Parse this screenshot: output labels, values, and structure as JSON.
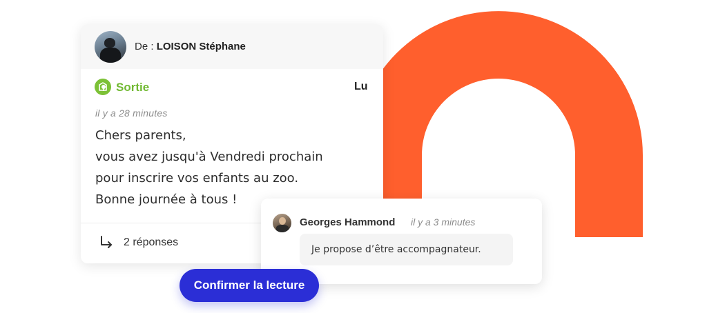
{
  "colors": {
    "accent_orange": "#ff5f2d",
    "category_green": "#7cc136",
    "button_blue": "#2b2ed6"
  },
  "message": {
    "from_prefix": "De :",
    "from_name": "LOISON Stéphane",
    "category": "Sortie",
    "category_icon": "outing-tree-icon",
    "read_status": "Lu",
    "time": "il y a 28 minutes",
    "body_lines": [
      "Chers parents,",
      "vous avez jusqu'à Vendredi prochain",
      "pour inscrire vos enfants au zoo.",
      "Bonne journée à tous !"
    ],
    "replies_icon": "reply-arrow-icon",
    "replies_label": "2 réponses"
  },
  "reply": {
    "author": "Georges Hammond",
    "time": "il y a 3 minutes",
    "text": "Je propose d’être accompagnateur."
  },
  "confirm_button": {
    "label": "Confirmer la lecture"
  }
}
